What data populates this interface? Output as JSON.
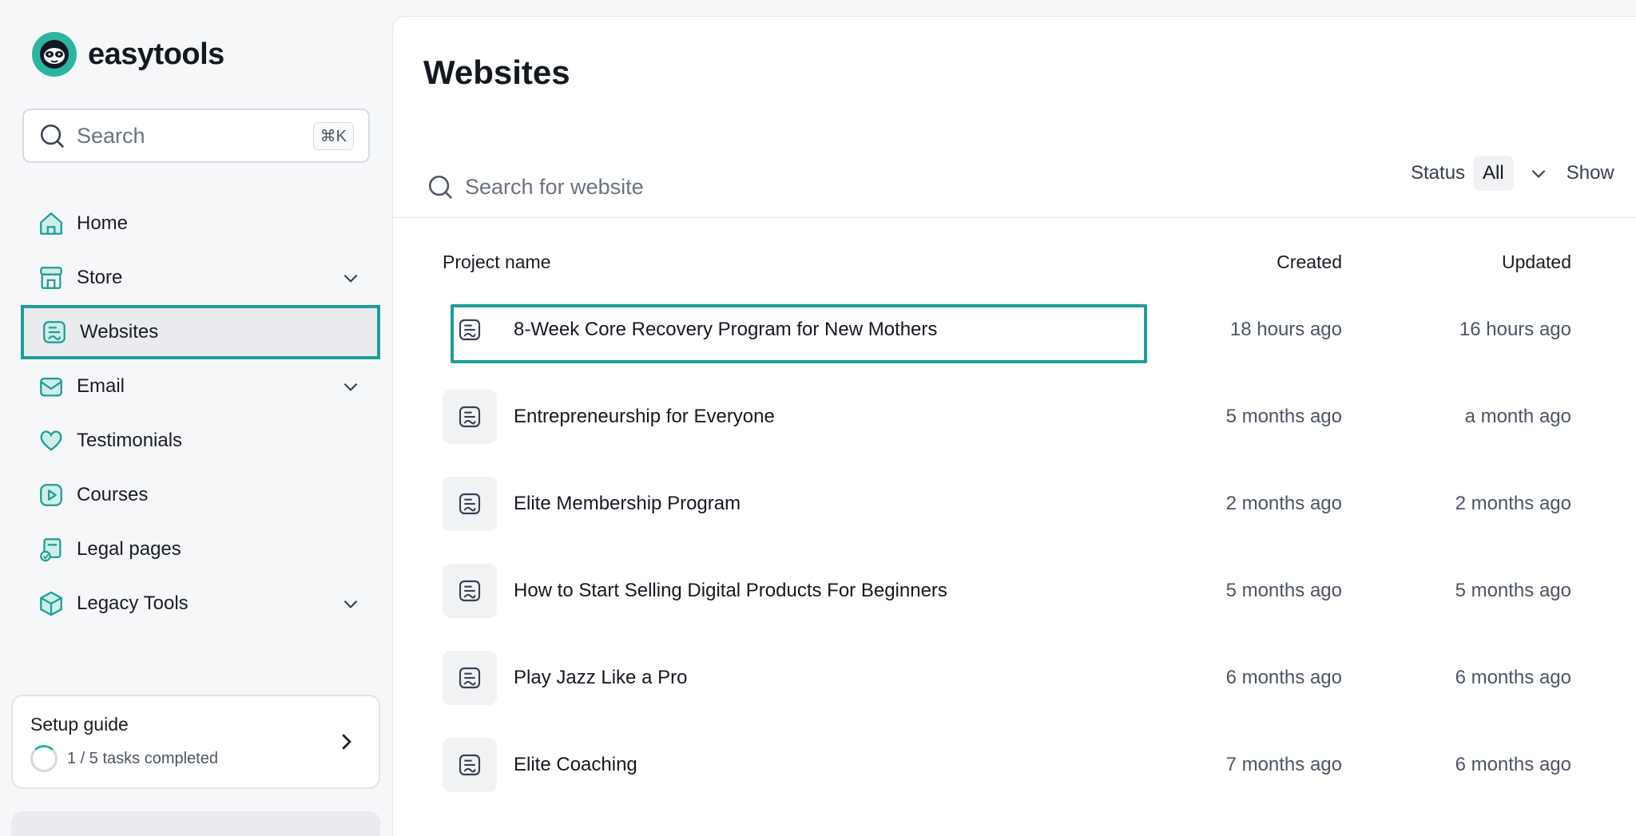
{
  "brand": {
    "name": "easytools"
  },
  "search": {
    "placeholder": "Search",
    "shortcut": "⌘K"
  },
  "nav": {
    "items": [
      {
        "label": "Home"
      },
      {
        "label": "Store"
      },
      {
        "label": "Websites"
      },
      {
        "label": "Email"
      },
      {
        "label": "Testimonials"
      },
      {
        "label": "Courses"
      },
      {
        "label": "Legal pages"
      },
      {
        "label": "Legacy Tools"
      }
    ]
  },
  "setup": {
    "title": "Setup guide",
    "progress": "1 / 5 tasks completed"
  },
  "main": {
    "title": "Websites",
    "search_placeholder": "Search for website",
    "status_label": "Status",
    "status_value": "All",
    "show_label": "Show",
    "columns": {
      "name": "Project name",
      "created": "Created",
      "updated": "Updated"
    },
    "rows": [
      {
        "name": "8-Week Core Recovery Program for New Mothers",
        "created": "18 hours ago",
        "updated": "16 hours ago"
      },
      {
        "name": "Entrepreneurship for Everyone",
        "created": "5 months ago",
        "updated": "a month ago"
      },
      {
        "name": "Elite Membership Program",
        "created": "2 months ago",
        "updated": "2 months ago"
      },
      {
        "name": "How to Start Selling Digital Products For Beginners",
        "created": "5 months ago",
        "updated": "5 months ago"
      },
      {
        "name": "Play Jazz Like a Pro",
        "created": "6 months ago",
        "updated": "6 months ago"
      },
      {
        "name": "Elite Coaching",
        "created": "7 months ago",
        "updated": "6 months ago"
      }
    ]
  },
  "colors": {
    "accent": "#2bb5a0",
    "highlight": "#1f9d97"
  }
}
